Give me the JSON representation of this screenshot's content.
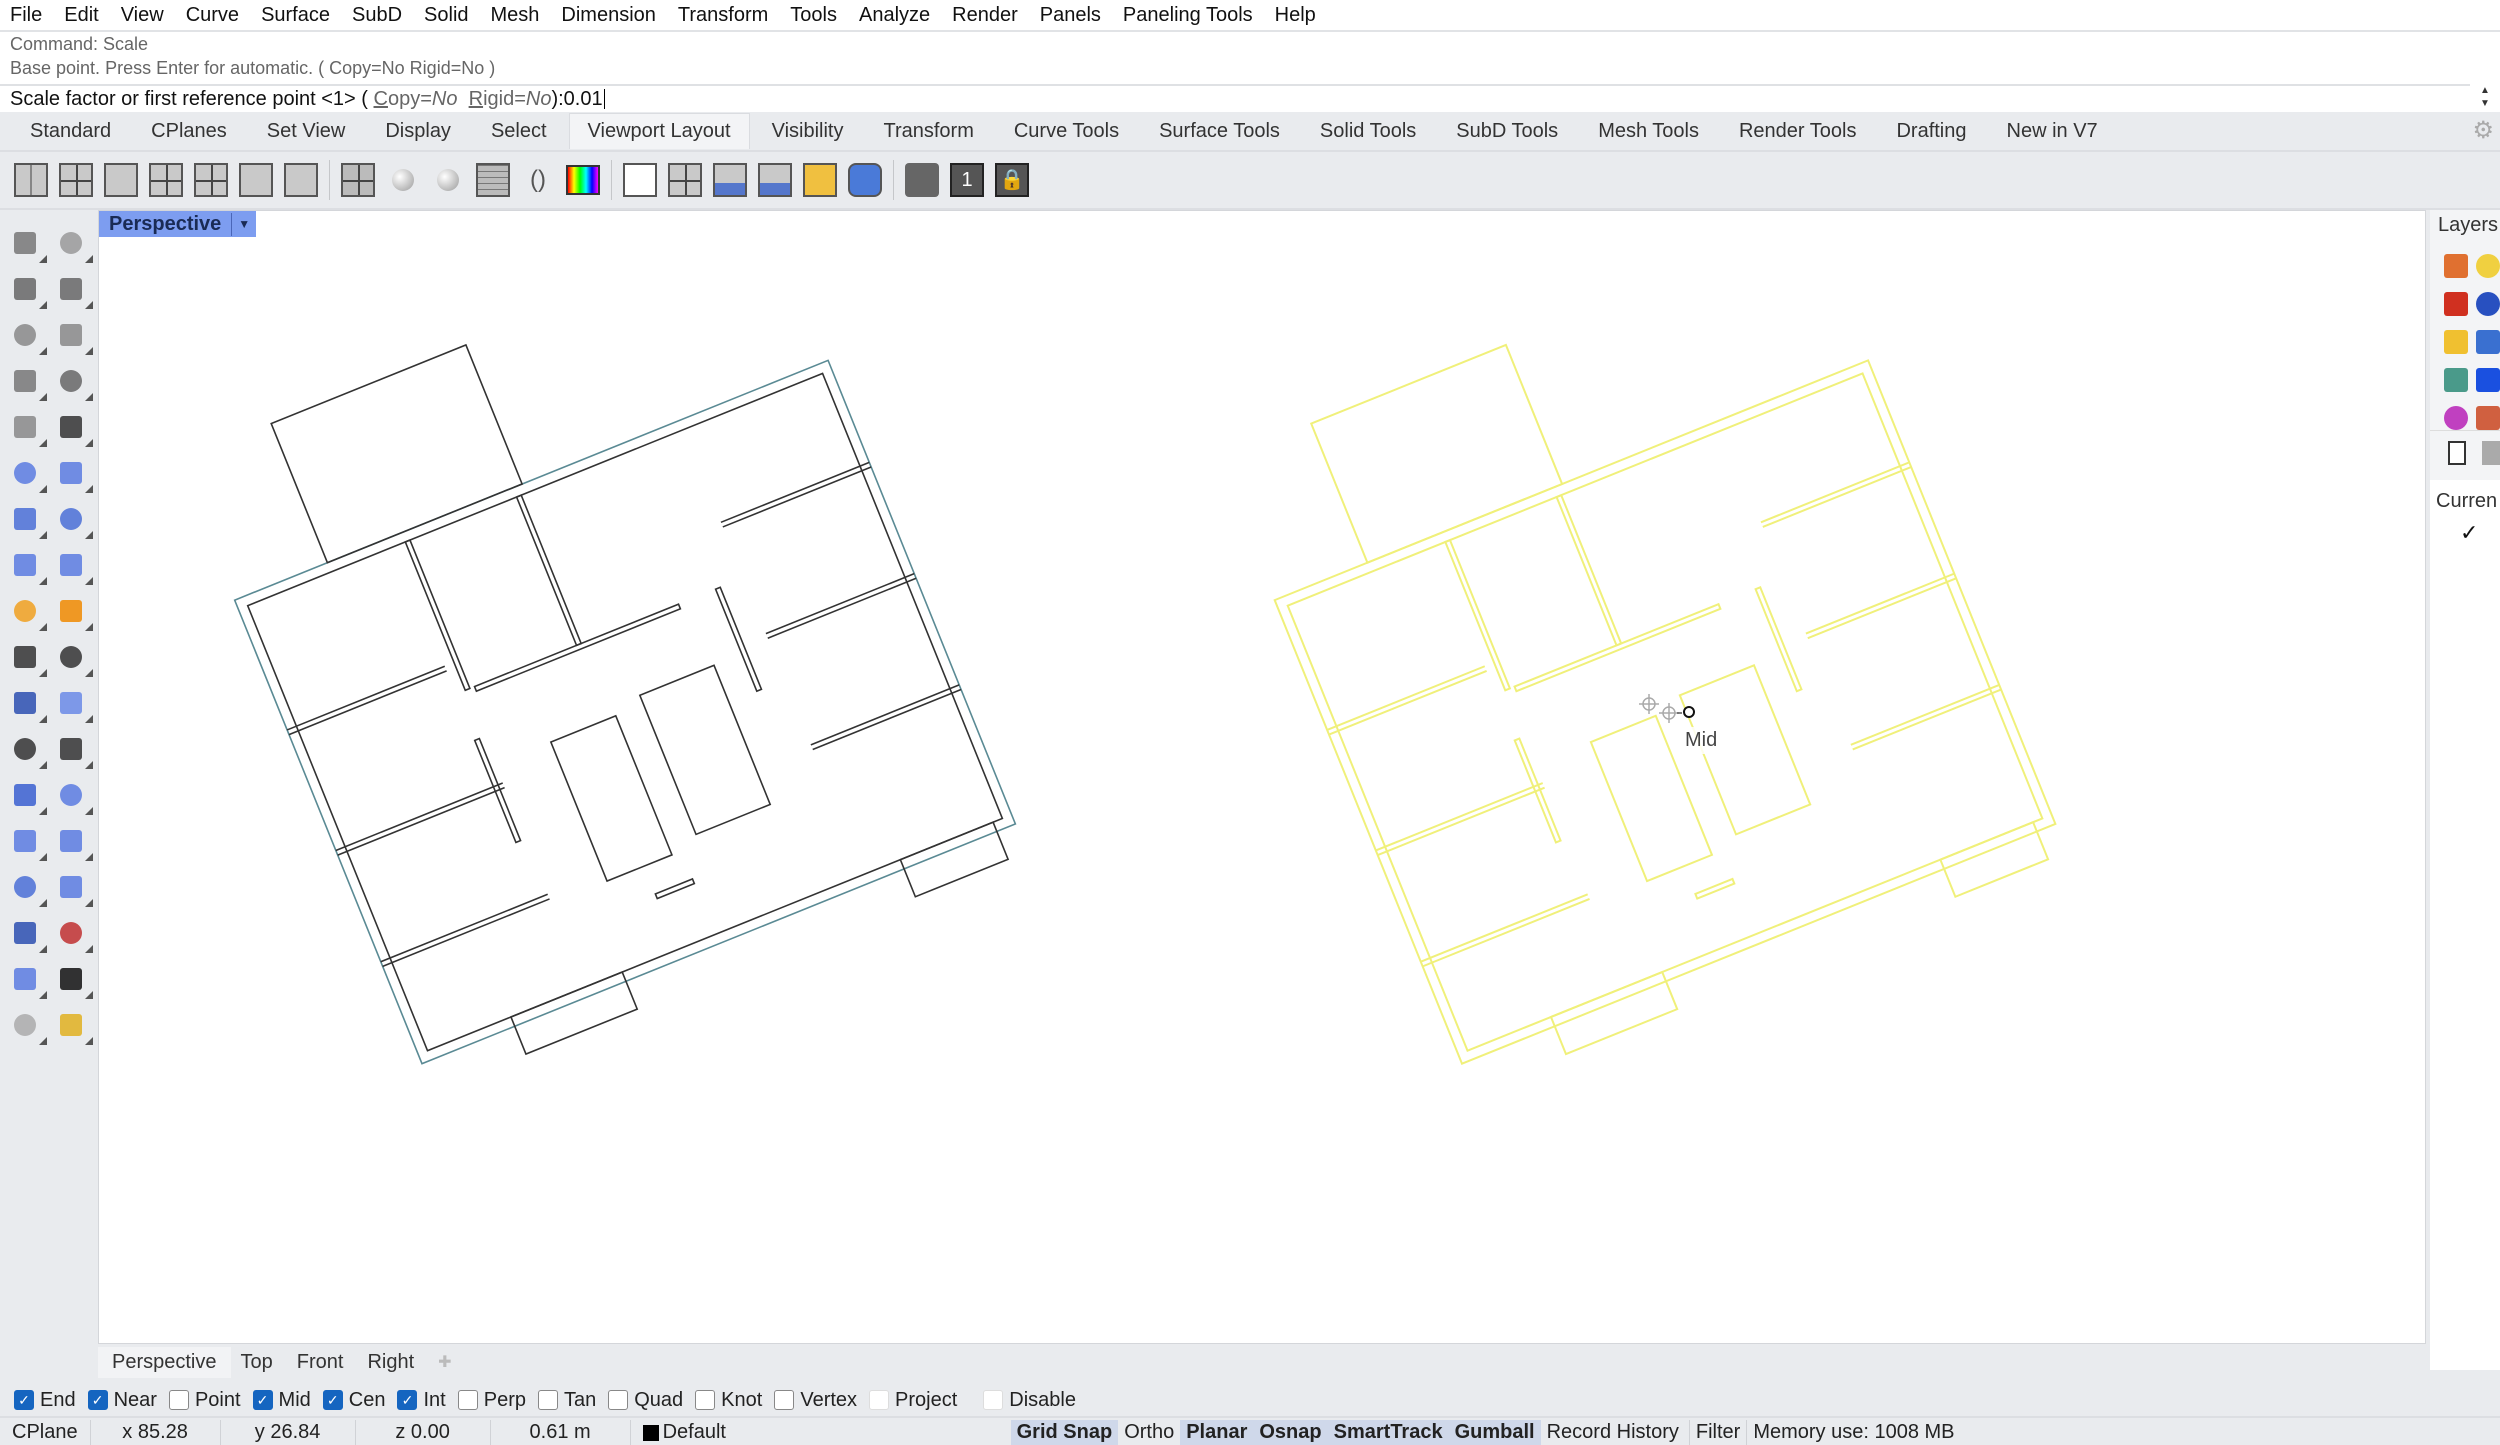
{
  "menu": [
    "File",
    "Edit",
    "View",
    "Curve",
    "Surface",
    "SubD",
    "Solid",
    "Mesh",
    "Dimension",
    "Transform",
    "Tools",
    "Analyze",
    "Render",
    "Panels",
    "Paneling Tools",
    "Help"
  ],
  "command": {
    "history": [
      "Command: Scale",
      "Base point. Press Enter for automatic. ( Copy=No  Rigid=No )"
    ],
    "prompt": "Scale factor or first reference point <1> (",
    "opt_copy_key": "C",
    "opt_copy_rest": "opy=",
    "opt_copy_val": "No",
    "opt_rigid_key": "R",
    "opt_rigid_rest": "igid=",
    "opt_rigid_val": "No",
    "prompt_end": " ):",
    "input_value": "0.01"
  },
  "toolbar_tabs": [
    {
      "label": "Standard",
      "active": false
    },
    {
      "label": "CPlanes",
      "active": false
    },
    {
      "label": "Set View",
      "active": false
    },
    {
      "label": "Display",
      "active": false
    },
    {
      "label": "Select",
      "active": false
    },
    {
      "label": "Viewport Layout",
      "active": true
    },
    {
      "label": "Visibility",
      "active": false
    },
    {
      "label": "Transform",
      "active": false
    },
    {
      "label": "Curve Tools",
      "active": false
    },
    {
      "label": "Surface Tools",
      "active": false
    },
    {
      "label": "Solid Tools",
      "active": false
    },
    {
      "label": "SubD Tools",
      "active": false
    },
    {
      "label": "Mesh Tools",
      "active": false
    },
    {
      "label": "Render Tools",
      "active": false
    },
    {
      "label": "Drafting",
      "active": false
    },
    {
      "label": "New in V7",
      "active": false
    }
  ],
  "toolbar_icons": [
    "split-vertical-icon",
    "four-viewports-icon",
    "single-viewport-icon",
    "maximize-viewport-icon",
    "viewport-layout-icon",
    "split-horizontal-icon",
    "split-vertical-2-icon",
    "grid-snap-layout-icon",
    "perspective-sphere-icon",
    "two-point-perspective-icon",
    "grid-axes-icon",
    "lens-icon",
    "color-display-icon",
    "new-layout-icon",
    "viewport-properties-icon",
    "capture-viewport-icon",
    "capture-to-file-icon",
    "open-viewport-icon",
    "camera-icon",
    "print-icon",
    "viewport-number-icon",
    "lock-viewport-icon"
  ],
  "left_tools": [
    "select-icon",
    "point-icon",
    "polyline-icon",
    "curve-icon",
    "circle-icon",
    "ellipse-icon",
    "arc-icon",
    "rectangle-icon",
    "polygon-icon",
    "fillet-curve-icon",
    "surface-icon",
    "extrude-surface-icon",
    "box-icon",
    "sphere-icon",
    "cylinder-icon",
    "patch-surface-icon",
    "join-icon",
    "explode-icon",
    "split-icon",
    "trim-icon",
    "boolean-icon",
    "point-cloud-icon",
    "offset-curve-icon",
    "rebuild-curve-icon",
    "text-icon",
    "move-icon",
    "group-icon",
    "orient-icon",
    "solid-edit-icon",
    "project-icon",
    "array-icon",
    "align-icon",
    "analyze-icon",
    "check-icon",
    "solid-tools-icon",
    "render-icon"
  ],
  "viewport": {
    "title": "Perspective",
    "snap_tooltip": "Mid",
    "tabs": [
      {
        "label": "Perspective",
        "active": true
      },
      {
        "label": "Top",
        "active": false
      },
      {
        "label": "Front",
        "active": false
      },
      {
        "label": "Right",
        "active": false
      }
    ]
  },
  "osnaps": [
    {
      "label": "End",
      "checked": true
    },
    {
      "label": "Near",
      "checked": true
    },
    {
      "label": "Point",
      "checked": false
    },
    {
      "label": "Mid",
      "checked": true
    },
    {
      "label": "Cen",
      "checked": true
    },
    {
      "label": "Int",
      "checked": true
    },
    {
      "label": "Perp",
      "checked": false
    },
    {
      "label": "Tan",
      "checked": false
    },
    {
      "label": "Quad",
      "checked": false
    },
    {
      "label": "Knot",
      "checked": false
    },
    {
      "label": "Vertex",
      "checked": false
    },
    {
      "label": "Project",
      "checked": false
    },
    {
      "label": "Disable",
      "checked": false
    }
  ],
  "status": {
    "cplane": "CPlane",
    "x": "x 85.28",
    "y": "y 26.84",
    "z": "z 0.00",
    "distance": "0.61 m",
    "layer": "Default",
    "toggles": [
      {
        "label": "Grid Snap",
        "on": true
      },
      {
        "label": "Ortho",
        "on": false
      },
      {
        "label": "Planar",
        "on": true
      },
      {
        "label": "Osnap",
        "on": true
      },
      {
        "label": "SmartTrack",
        "on": true
      },
      {
        "label": "Gumball",
        "on": true
      },
      {
        "label": "Record History",
        "on": false
      },
      {
        "label": "Filter",
        "on": false
      }
    ],
    "memory": "Memory use: 1008 MB"
  },
  "layers_panel": {
    "title": "Layers",
    "column_header": "Curren",
    "current_check": "✓",
    "icons": [
      "edit-layer-icon",
      "lightbulb-icon",
      "sun-icon",
      "material-icon",
      "folder-icon",
      "help-icon",
      "grid-icon",
      "notification-icon",
      "color-wheel-icon",
      "display-icon"
    ]
  },
  "colors": {
    "accent": "#7d9df0",
    "selection": "#f3f39a",
    "checkbox": "#1565c0"
  }
}
